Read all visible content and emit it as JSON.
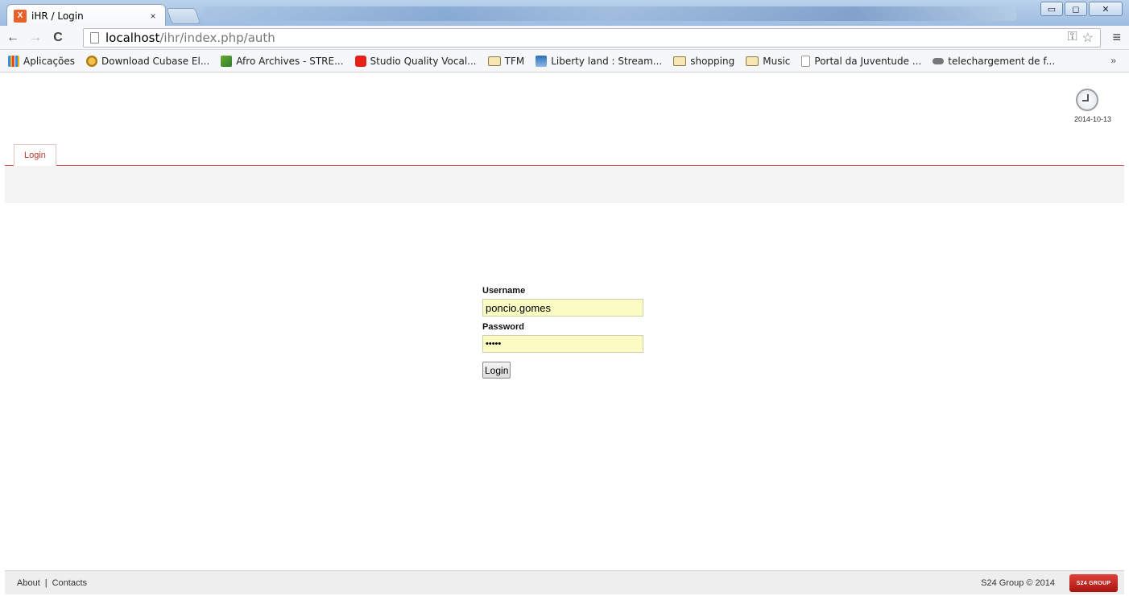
{
  "browser": {
    "tab_favicon": "X",
    "tab_title": "iHR / Login",
    "tab_close": "×",
    "url_host": "localhost",
    "url_path": "/ihr/index.php/auth",
    "window_buttons": {
      "minimize": "▭",
      "maximize": "◻",
      "close": "✕"
    },
    "more_bookmarks": "»",
    "bookmarks": [
      {
        "label": "Aplicações",
        "icon": "apps-icon"
      },
      {
        "label": "Download Cubase El...",
        "icon": "cubase-icon"
      },
      {
        "label": "Afro Archives - STRE...",
        "icon": "afro-icon"
      },
      {
        "label": "Studio Quality Vocal...",
        "icon": "youtube-icon"
      },
      {
        "label": "TFM",
        "icon": "folder-icon"
      },
      {
        "label": "Liberty land : Stream...",
        "icon": "liberty-icon"
      },
      {
        "label": "shopping",
        "icon": "folder-icon"
      },
      {
        "label": "Music",
        "icon": "folder-icon"
      },
      {
        "label": "Portal da Juventude ...",
        "icon": "page-icon"
      },
      {
        "label": "telechargement de f...",
        "icon": "key-icon"
      }
    ]
  },
  "header": {
    "date": "2014-10-13",
    "nav_tab": "Login"
  },
  "login": {
    "username_label": "Username",
    "username_value": "poncio.gomes",
    "password_label": "Password",
    "password_value": "•••••",
    "submit_label": "Login"
  },
  "footer": {
    "about": "About",
    "separator": "|",
    "contacts": "Contacts",
    "copyright": "S24 Group © 2014",
    "logo_text": "S24 GROUP"
  },
  "colors": {
    "accent": "#c0392b",
    "input_autofill": "#fbfbc4"
  }
}
